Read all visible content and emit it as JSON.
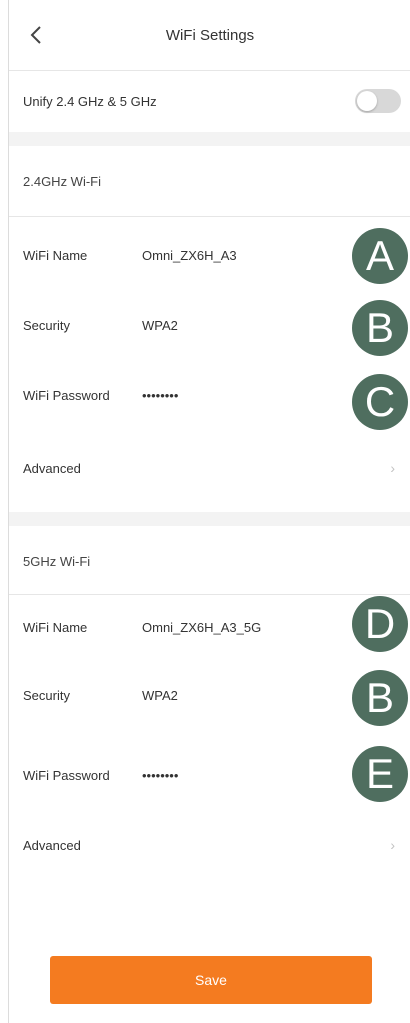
{
  "header": {
    "title": "WiFi Settings",
    "back_icon": "chevron-left-icon"
  },
  "unify": {
    "label": "Unify 2.4 GHz & 5 GHz",
    "enabled": false
  },
  "band_24": {
    "heading": "2.4GHz Wi-Fi",
    "name_label": "WiFi Name",
    "name_value": "Omni_ZX6H_A3",
    "security_label": "Security",
    "security_value": "WPA2",
    "password_label": "WiFi Password",
    "password_value": "••••••••",
    "advanced_label": "Advanced"
  },
  "band_5": {
    "heading": "5GHz Wi-Fi",
    "name_label": "WiFi Name",
    "name_value": "Omni_ZX6H_A3_5G",
    "security_label": "Security",
    "security_value": "WPA2",
    "password_label": "WiFi Password",
    "password_value": "••••••••",
    "advanced_label": "Advanced"
  },
  "annotations": {
    "a": "A",
    "b1": "B",
    "c": "C",
    "d": "D",
    "b2": "B",
    "e": "E",
    "color": "#4f6e5f"
  },
  "save_label": "Save",
  "colors": {
    "accent": "#f47b20",
    "toggle_off": "#d8d8d8"
  }
}
